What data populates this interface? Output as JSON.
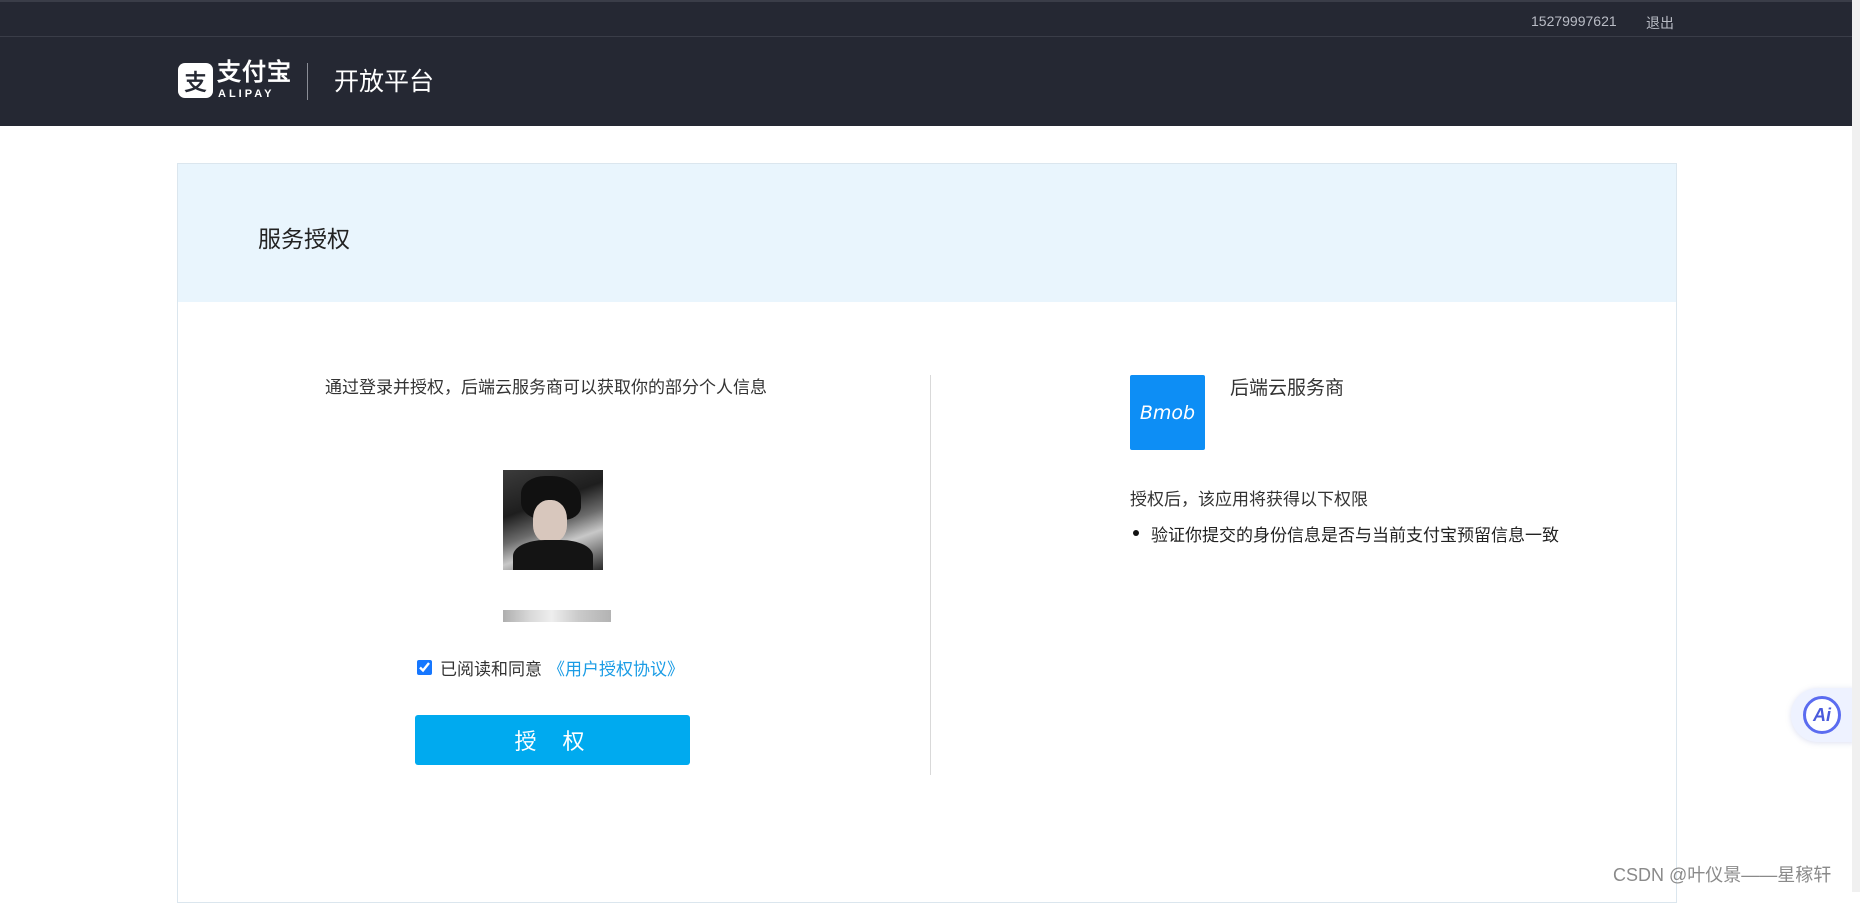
{
  "topbar": {
    "account": "15279997621",
    "logout_label": "退出"
  },
  "header": {
    "logo_mark": "支",
    "logo_text": "支付宝",
    "logo_sub": "ALIPAY",
    "platform_title": "开放平台"
  },
  "panel": {
    "title": "服务授权"
  },
  "left": {
    "intro": "通过登录并授权，后端云服务商可以获取你的部分个人信息",
    "agree_label": "已阅读和同意",
    "agree_link": "《用户授权协议》",
    "agree_checked": true,
    "auth_button": "授 权"
  },
  "right": {
    "app_logo_text": "Bmob",
    "app_name": "后端云服务商",
    "perm_title": "授权后，该应用将获得以下权限",
    "permissions": [
      "验证你提交的身份信息是否与当前支付宝预留信息一致"
    ]
  },
  "floating": {
    "ai_label": "Ai"
  },
  "watermark": "CSDN @叶仪景——星稼轩",
  "colors": {
    "header_bg": "#252833",
    "panel_head_bg": "#e9f5fd",
    "button_bg": "#00aaef",
    "link": "#1a9ce5",
    "app_logo_bg": "#0d8ef5"
  }
}
